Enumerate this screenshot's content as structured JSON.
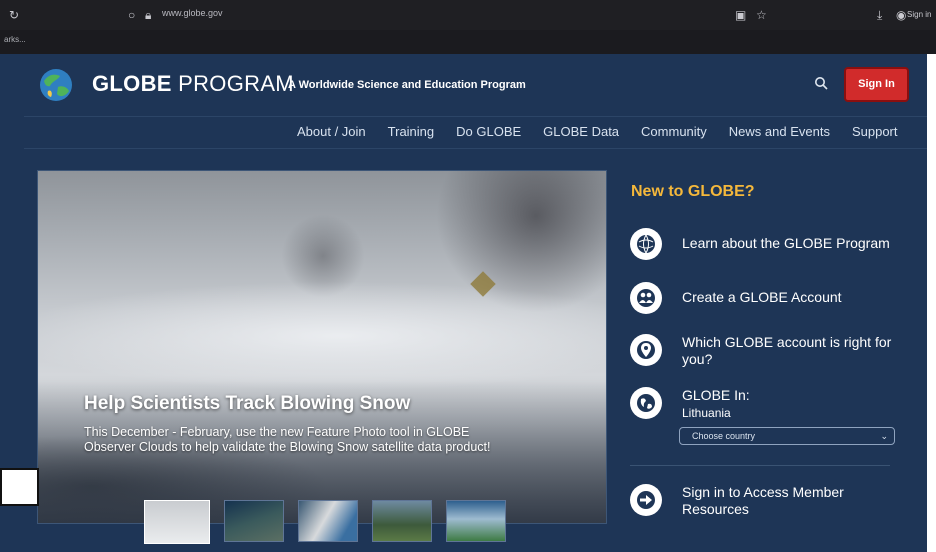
{
  "browser": {
    "url": "www.globe.gov",
    "signin_text": "Sign in",
    "bookmarks_label": "arks..."
  },
  "header": {
    "logo_bold": "GLOBE",
    "logo_rest": " PROGRAM",
    "tagline": "A Worldwide Science and Education Program",
    "signin_label": "Sign In",
    "signin_color": "#d12b2b"
  },
  "nav": {
    "items": [
      "About / Join",
      "Training",
      "Do GLOBE",
      "GLOBE Data",
      "Community",
      "News and Events",
      "Support"
    ]
  },
  "hero": {
    "title": "Help Scientists Track Blowing Snow",
    "description": "This December - February, use the new Feature Photo tool in GLOBE Observer Clouds to help validate the Blowing Snow satellite data product!",
    "thumbnails": [
      "slide-1",
      "slide-2",
      "slide-3",
      "slide-4",
      "slide-5"
    ],
    "active_thumbnail": 1
  },
  "panel": {
    "title": "New to GLOBE?",
    "title_color": "#f5b83b",
    "items": [
      {
        "label": "Learn about the GLOBE Program",
        "icon": "globe-icon"
      },
      {
        "label": "Create a GLOBE Account",
        "icon": "people-icon"
      },
      {
        "label": "Which GLOBE account is right for you?",
        "icon": "location-pin-icon"
      },
      {
        "label": "GLOBE In:",
        "icon": "world-icon"
      },
      {
        "label": "Sign in to Access Member Resources",
        "icon": "arrow-right-icon"
      }
    ],
    "country_current": "Lithuania",
    "country_select_placeholder": "Choose country"
  }
}
